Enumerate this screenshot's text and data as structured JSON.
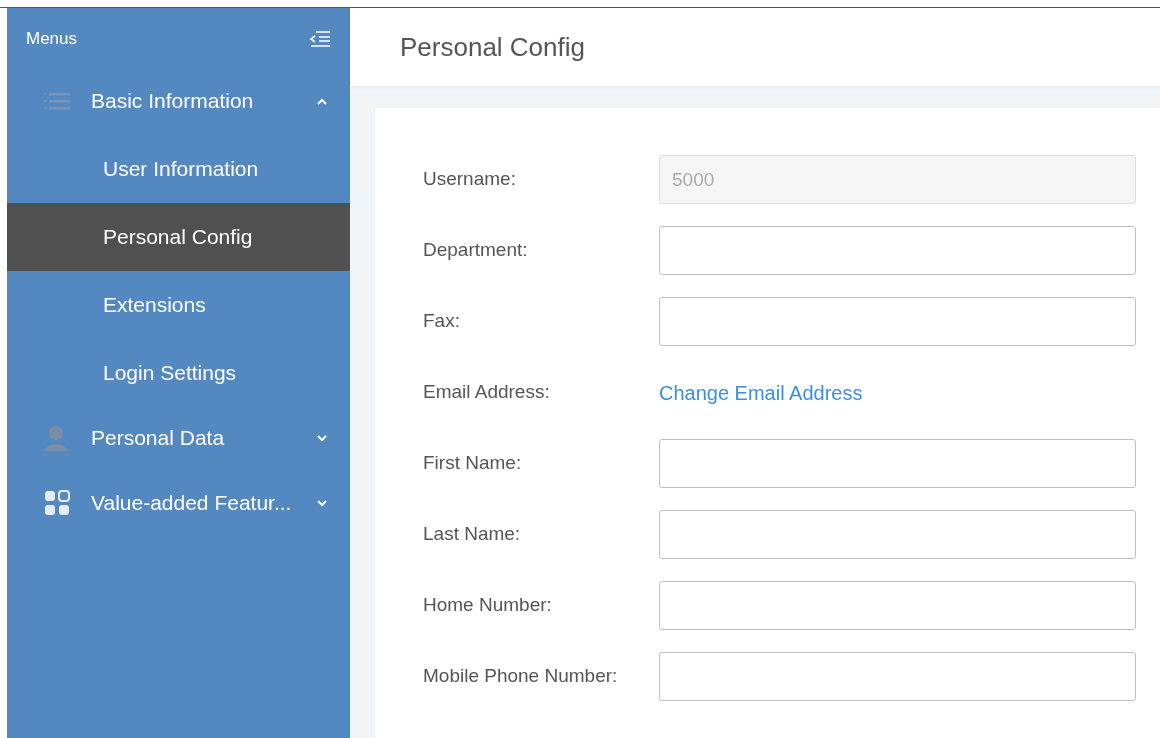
{
  "sidebar": {
    "title": "Menus",
    "groups": [
      {
        "label": "Basic Information",
        "kind": "list",
        "expanded": true,
        "children": [
          {
            "label": "User Information",
            "selected": false
          },
          {
            "label": "Personal Config",
            "selected": true
          },
          {
            "label": "Extensions",
            "selected": false
          },
          {
            "label": "Login Settings",
            "selected": false
          }
        ]
      },
      {
        "label": "Personal Data",
        "kind": "person",
        "expanded": false
      },
      {
        "label": "Value-added Featur...",
        "kind": "apps",
        "expanded": false
      }
    ]
  },
  "page": {
    "title": "Personal Config"
  },
  "form": {
    "fields": [
      {
        "label": "Username:",
        "kind": "input",
        "value": "5000",
        "disabled": true
      },
      {
        "label": "Department:",
        "kind": "input",
        "disabled": false
      },
      {
        "label": "Fax:",
        "kind": "input",
        "disabled": false
      },
      {
        "label": "Email Address:",
        "kind": "link",
        "link": "Change Email Address"
      },
      {
        "label": "First Name:",
        "kind": "input",
        "disabled": false
      },
      {
        "label": "Last Name:",
        "kind": "input",
        "disabled": false
      },
      {
        "label": "Home Number:",
        "kind": "input",
        "disabled": false
      },
      {
        "label": "Mobile Phone Number:",
        "kind": "input",
        "disabled": false
      }
    ]
  }
}
